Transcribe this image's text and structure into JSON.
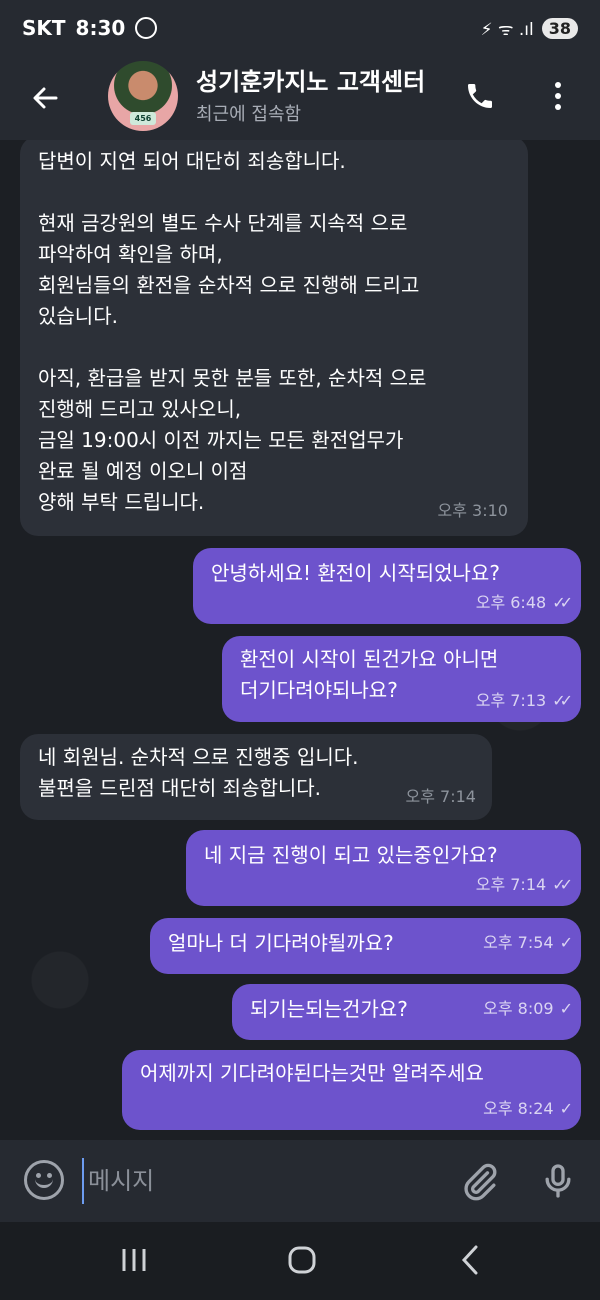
{
  "status": {
    "carrier": "SKT",
    "time": "8:30",
    "signal_text": "⚡ ᯤ .ıl",
    "battery": "38"
  },
  "header": {
    "title": "성기훈카지노 고객센터",
    "subtitle": "최근에 접속함",
    "avatar_badge": "456"
  },
  "messages": [
    {
      "direction": "in",
      "text": "답변이 지연 되어 대단히 죄송합니다.\n\n현재 금강원의 별도 수사 단계를 지속적 으로\n파악하여 확인을 하며,\n회원님들의 환전을 순차적 으로 진행해 드리고\n있습니다.\n\n아직, 환급을 받지 못한 분들 또한, 순차적 으로\n진행해 드리고 있사오니,\n금일 19:00시 이전 까지는 모든 환전업무가\n완료 될 예정 이오니 이점\n양해 부탁 드립니다.",
      "time": "오후 3:10"
    },
    {
      "direction": "out",
      "text": "안녕하세요! 환전이 시작되었나요?",
      "time": "오후 6:48",
      "check": "✓✓"
    },
    {
      "direction": "out",
      "text": "환전이 시작이 된건가요 아니면\n더기다려야되나요?",
      "time": "오후 7:13",
      "check": "✓✓"
    },
    {
      "direction": "in",
      "text": "네 회원님. 순차적 으로 진행중 입니다.\n불편을 드린점 대단히 죄송합니다.",
      "time": "오후 7:14"
    },
    {
      "direction": "out",
      "text": "네 지금 진행이 되고 있는중인가요?",
      "time": "오후 7:14",
      "check": "✓✓"
    },
    {
      "direction": "out",
      "text": "얼마나 더 기다려야될까요?",
      "time": "오후 7:54",
      "check": "✓"
    },
    {
      "direction": "out",
      "text": "되기는되는건가요?",
      "time": "오후 8:09",
      "check": "✓"
    },
    {
      "direction": "out",
      "text": "어제까지 기다려야된다는것만 알려주세요",
      "time": "오후 8:24",
      "check": "✓"
    }
  ],
  "composer": {
    "placeholder": "메시지"
  },
  "colors": {
    "outgoing_bubble": "#6d53cc",
    "incoming_bubble": "#2c3038",
    "background": "#1c1f24"
  }
}
